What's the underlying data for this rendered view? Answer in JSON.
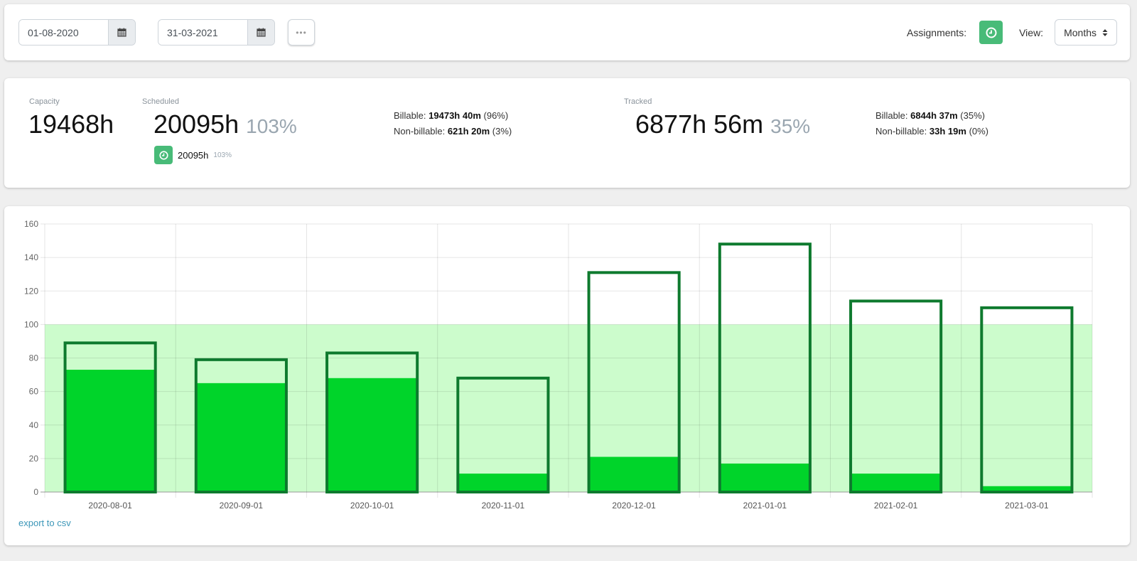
{
  "toolbar": {
    "start_date": "01-08-2020",
    "end_date": "31-03-2021",
    "more_label": "•••",
    "assignments_label": "Assignments:",
    "view_label": "View:",
    "view_value": "Months",
    "accent_color": "#48bb78"
  },
  "summary": {
    "capacity": {
      "label": "Capacity",
      "value": "19468h"
    },
    "scheduled": {
      "label": "Scheduled",
      "value": "20095h",
      "percent": "103%",
      "assignment_value": "20095h",
      "assignment_percent": "103%",
      "billable_label": "Billable:",
      "billable_value": "19473h 40m",
      "billable_pct": "(96%)",
      "nonbillable_label": "Non-billable:",
      "nonbillable_value": "621h 20m",
      "nonbillable_pct": "(3%)"
    },
    "tracked": {
      "label": "Tracked",
      "value": "6877h 56m",
      "percent": "35%",
      "billable_label": "Billable:",
      "billable_value": "6844h 37m",
      "billable_pct": "(35%)",
      "nonbillable_label": "Non-billable:",
      "nonbillable_value": "33h 19m",
      "nonbillable_pct": "(0%)"
    }
  },
  "chart_data": {
    "type": "bar",
    "title": "",
    "xlabel": "",
    "ylabel": "",
    "ylim": [
      0,
      160
    ],
    "yticks": [
      0,
      20,
      40,
      60,
      80,
      100,
      120,
      140,
      160
    ],
    "grid": true,
    "legend": "none",
    "categories": [
      "2020-08-01",
      "2020-09-01",
      "2020-10-01",
      "2020-11-01",
      "2020-12-01",
      "2021-01-01",
      "2021-02-01",
      "2021-03-01"
    ],
    "capacity_band": 100,
    "series": [
      {
        "name": "Scheduled",
        "style": "outline",
        "color": "#0e7a2e",
        "values": [
          89,
          79,
          83,
          68,
          131,
          148,
          114,
          110
        ]
      },
      {
        "name": "Tracked",
        "style": "filled",
        "color": "#00d42a",
        "values": [
          73,
          65,
          68,
          11,
          21,
          17,
          11,
          3.5
        ]
      }
    ],
    "band_color": "#ccfccc"
  },
  "footer": {
    "export_label": "export to csv"
  }
}
